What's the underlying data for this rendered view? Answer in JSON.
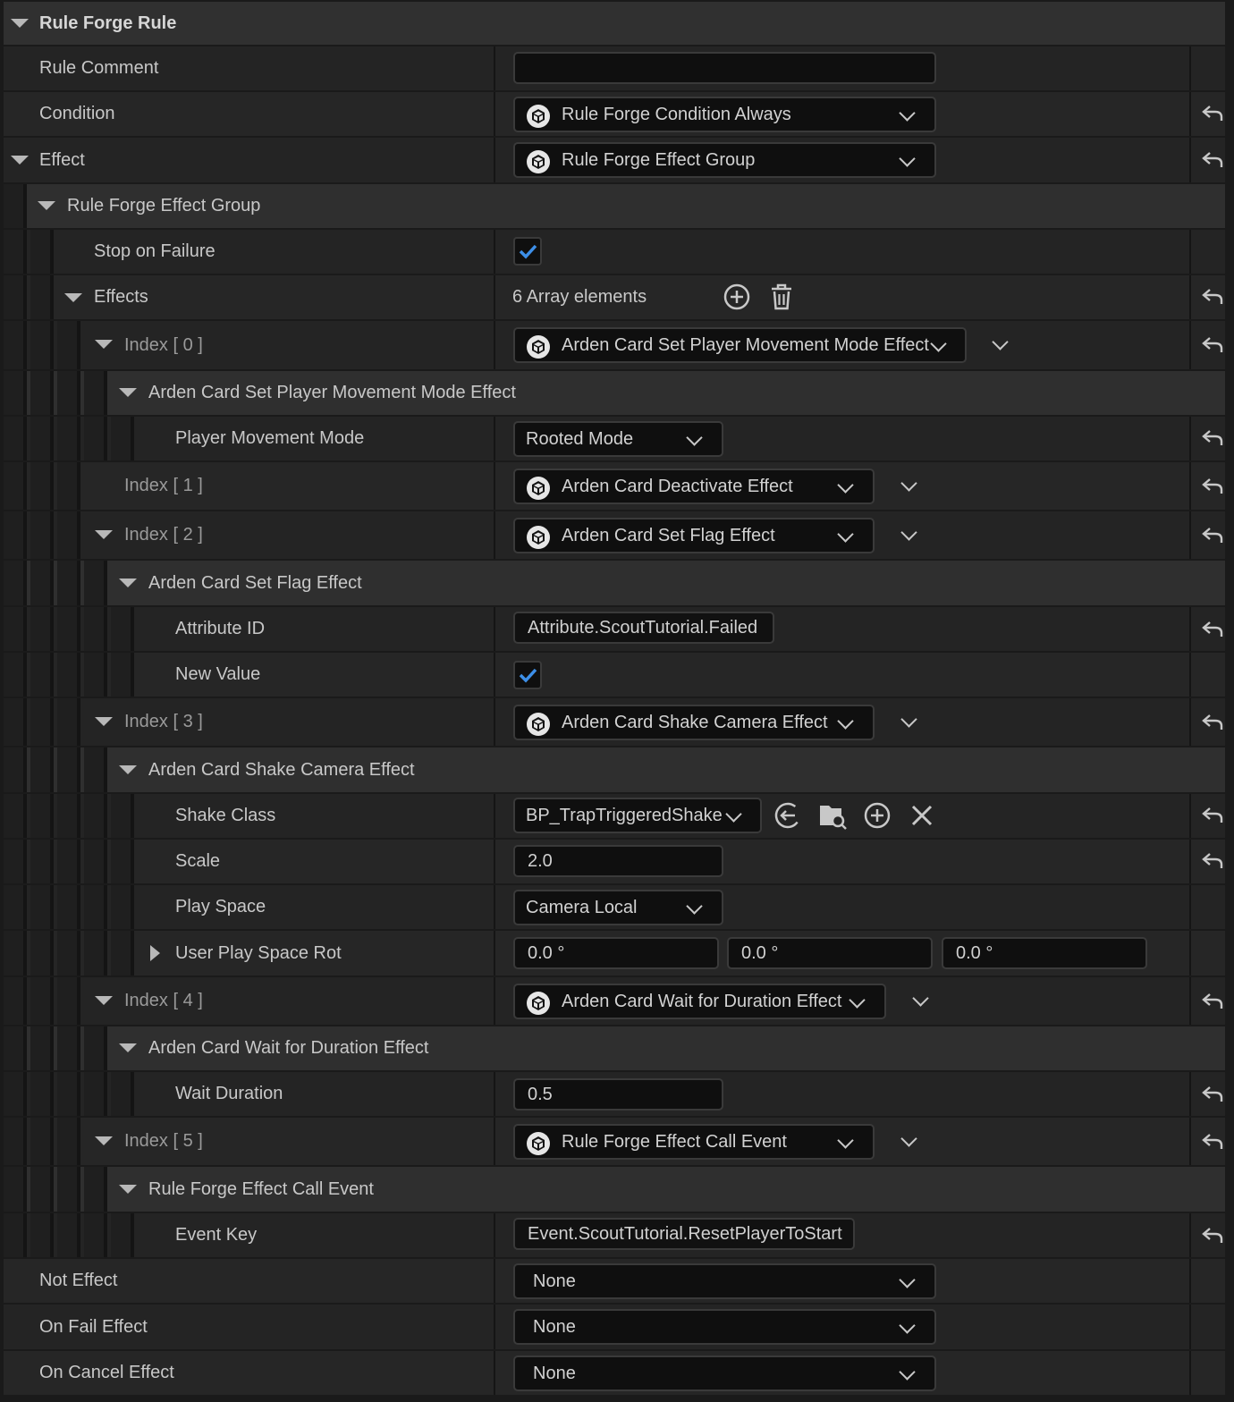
{
  "header": {
    "title": "Rule Forge Rule"
  },
  "rule_comment": {
    "label": "Rule Comment",
    "value": ""
  },
  "condition": {
    "label": "Condition",
    "value": "Rule Forge Condition Always"
  },
  "effect": {
    "label": "Effect",
    "value": "Rule Forge Effect Group"
  },
  "effect_group": {
    "title": "Rule Forge Effect Group",
    "stop_on_failure": {
      "label": "Stop on Failure",
      "checked": true
    },
    "effects": {
      "label": "Effects",
      "count_text": "6 Array elements"
    }
  },
  "items": [
    {
      "index": "Index [ 0 ]",
      "value": "Arden Card Set Player Movement Mode Effect",
      "title": "Arden Card Set Player Movement Mode Effect",
      "props": [
        {
          "label": "Player Movement Mode",
          "value": "Rooted Mode"
        }
      ]
    },
    {
      "index": "Index [ 1 ]",
      "value": "Arden Card Deactivate Effect"
    },
    {
      "index": "Index [ 2 ]",
      "value": "Arden Card Set Flag Effect",
      "title": "Arden Card Set Flag Effect",
      "props": [
        {
          "label": "Attribute ID",
          "value": "Attribute.ScoutTutorial.Failed"
        },
        {
          "label": "New Value",
          "checked": true
        }
      ]
    },
    {
      "index": "Index [ 3 ]",
      "value": "Arden Card Shake Camera Effect",
      "title": "Arden Card Shake Camera Effect",
      "props": [
        {
          "label": "Shake Class",
          "value": "BP_TrapTriggeredShake"
        },
        {
          "label": "Scale",
          "value": "2.0"
        },
        {
          "label": "Play Space",
          "value": "Camera Local"
        },
        {
          "label": "User Play Space Rot",
          "values": [
            "0.0 °",
            "0.0 °",
            "0.0 °"
          ]
        }
      ]
    },
    {
      "index": "Index [ 4 ]",
      "value": "Arden Card Wait for Duration Effect",
      "title": "Arden Card Wait for Duration Effect",
      "props": [
        {
          "label": "Wait Duration",
          "value": "0.5"
        }
      ]
    },
    {
      "index": "Index [ 5 ]",
      "value": "Rule Forge Effect Call Event",
      "title": "Rule Forge Effect Call Event",
      "props": [
        {
          "label": "Event Key",
          "value": "Event.ScoutTutorial.ResetPlayerToStart"
        }
      ]
    }
  ],
  "not_effect": {
    "label": "Not Effect",
    "value": "None"
  },
  "on_fail_effect": {
    "label": "On Fail Effect",
    "value": "None"
  },
  "on_cancel_effect": {
    "label": "On Cancel Effect",
    "value": "None"
  },
  "icons": {
    "class": "class-cube-icon",
    "reset": "reset-to-default-icon",
    "expand": "expand-arrow-icon",
    "add": "add-element-icon",
    "delete": "delete-all-icon",
    "browse": "use-selected-icon",
    "find": "browse-asset-icon",
    "clear": "clear-icon"
  },
  "colors": {
    "checkmark": "#3d8fe8",
    "background": "#242424"
  }
}
